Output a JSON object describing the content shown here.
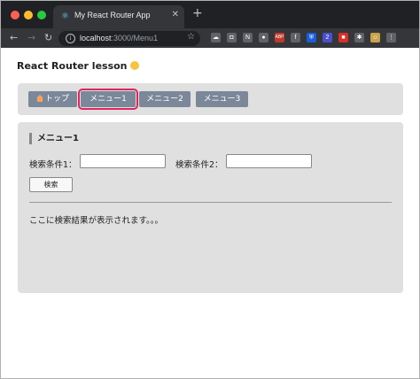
{
  "browser": {
    "tab_title": "My React Router App",
    "tab_close": "✕",
    "new_tab": "+",
    "url_host": "localhost",
    "url_rest": ":3000/Menu1",
    "nav": {
      "back": "←",
      "forward": "→",
      "reload": "↻"
    },
    "star": "☆",
    "extensions": [
      {
        "icon": "cloud-icon",
        "glyph": "☁",
        "color": "#5f6368"
      },
      {
        "icon": "pocket-icon",
        "glyph": "◘",
        "color": "#5f6368"
      },
      {
        "icon": "notion-icon",
        "glyph": "N",
        "color": "#5f6368"
      },
      {
        "icon": "mask-icon",
        "glyph": "●",
        "color": "#5f6368"
      },
      {
        "icon": "abp-icon",
        "glyph": "ABP",
        "color": "#c0392b"
      },
      {
        "icon": "formula-icon",
        "glyph": "f",
        "color": "#5f6368"
      },
      {
        "icon": "bitwarden-icon",
        "glyph": "⛨",
        "color": "#175ddc"
      },
      {
        "icon": "badge-2-icon",
        "glyph": "2",
        "color": "#4a4fd0"
      },
      {
        "icon": "red-ext-icon",
        "glyph": "■",
        "color": "#d93025"
      },
      {
        "icon": "puzzle-icon",
        "glyph": "✱",
        "color": "#5f6368"
      },
      {
        "icon": "avatar-icon",
        "glyph": "☺",
        "color": "#c9a34a"
      },
      {
        "icon": "more-icon",
        "glyph": "⋮",
        "color": "#5f6368"
      }
    ]
  },
  "page": {
    "title": "React Router lesson",
    "nav": {
      "top": "トップ",
      "menu1": "メニュー1",
      "menu2": "メニュー2",
      "menu3": "メニュー3"
    },
    "section_title": "メニュー1",
    "label1": "検索条件1：",
    "label2": "検索条件2：",
    "input1_value": "",
    "input2_value": "",
    "search_button": "検索",
    "result_text": "ここに検索結果が表示されます。。。"
  },
  "colors": {
    "active_outline": "#e0245e",
    "nav_button": "#7a8899",
    "panel": "#e0e0e0"
  }
}
